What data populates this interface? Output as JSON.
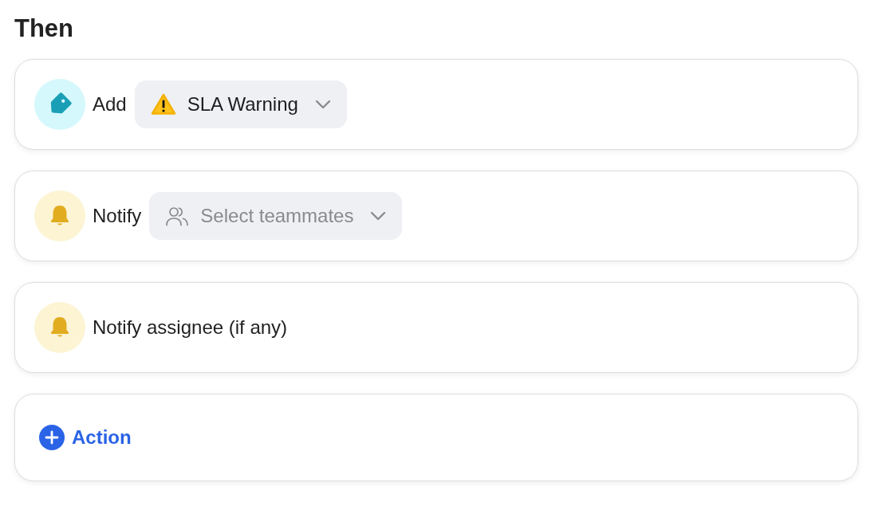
{
  "title": "Then",
  "actions": [
    {
      "kind": "tag",
      "label": "Add",
      "select": {
        "kind": "tag",
        "value": "SLA Warning"
      }
    },
    {
      "kind": "notify",
      "label": "Notify",
      "select": {
        "kind": "people",
        "placeholder": "Select teammates"
      }
    },
    {
      "kind": "notify",
      "label": "Notify assignee (if any)"
    }
  ],
  "add_action": {
    "label": "Action"
  }
}
